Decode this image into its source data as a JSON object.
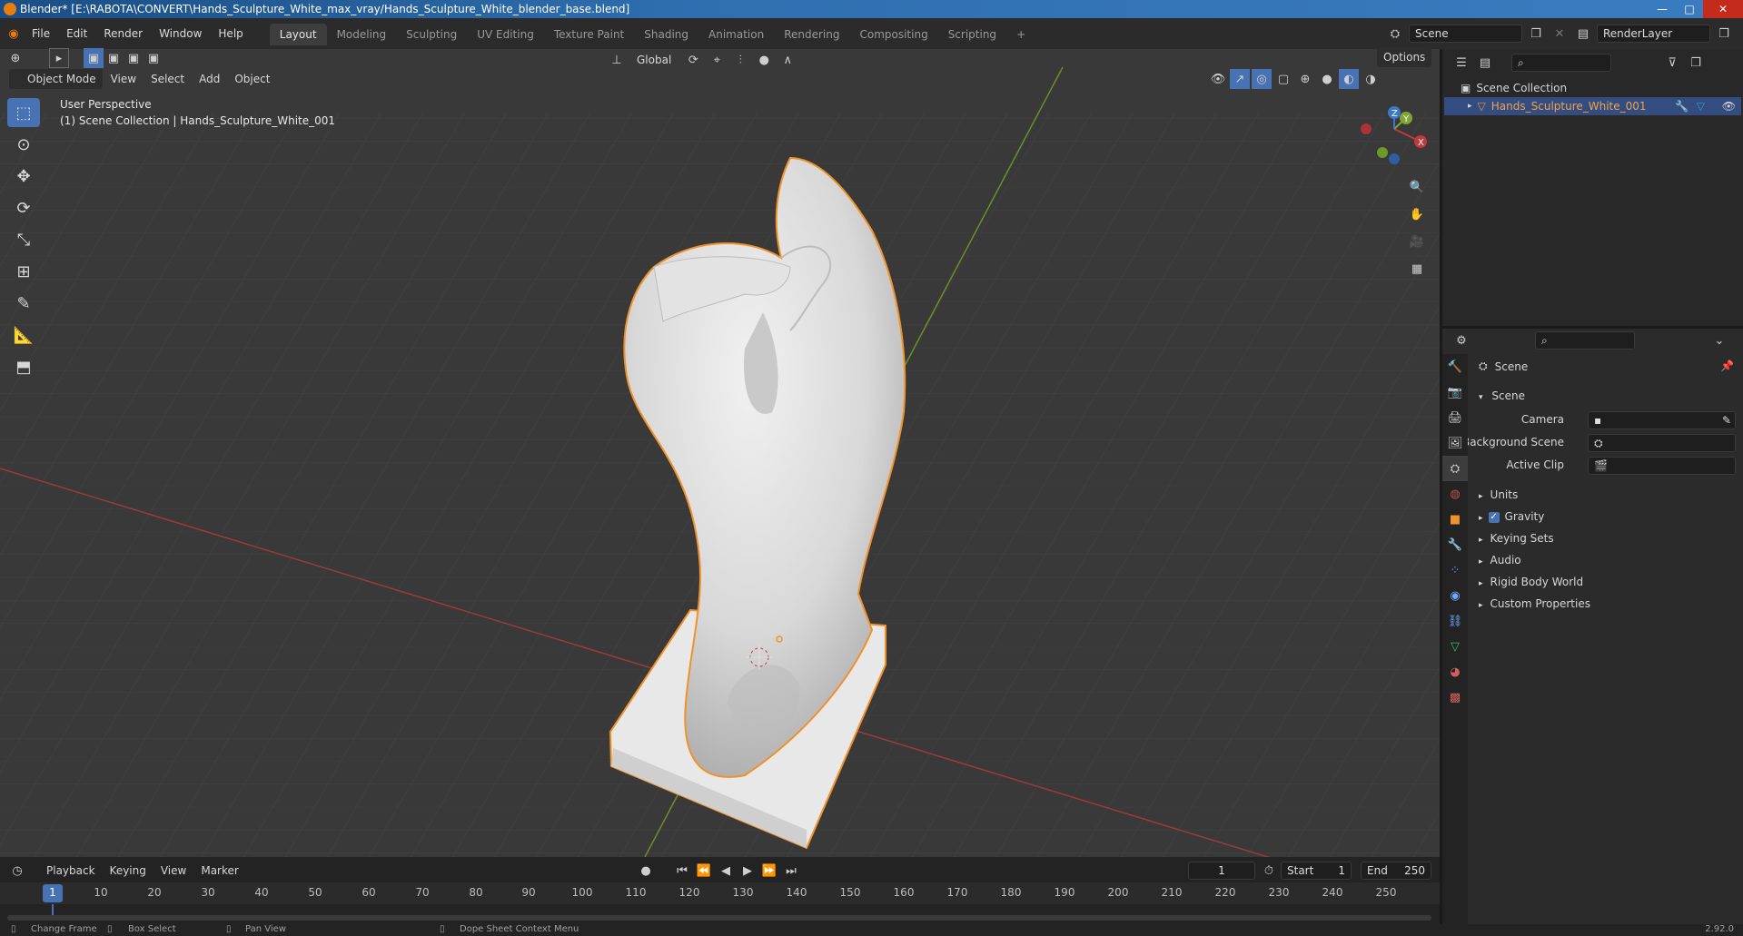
{
  "window": {
    "title": "Blender* [E:\\RABOTA\\CONVERT\\Hands_Sculpture_White_max_vray/Hands_Sculpture_White_blender_base.blend]",
    "minimize": "—",
    "maximize": "□",
    "close": "✕"
  },
  "menu": [
    "File",
    "Edit",
    "Render",
    "Window",
    "Help"
  ],
  "workspaces": [
    "Layout",
    "Modeling",
    "Sculpting",
    "UV Editing",
    "Texture Paint",
    "Shading",
    "Animation",
    "Rendering",
    "Compositing",
    "Scripting"
  ],
  "active_workspace": "Layout",
  "add_workspace": "+",
  "scene_field": "Scene",
  "renderlayer_field": "RenderLayer",
  "viewport_header": {
    "transform_orientation": "Global",
    "options": "Options",
    "mode": "Object Mode",
    "menus": [
      "View",
      "Select",
      "Add",
      "Object"
    ]
  },
  "viewport_overlay": {
    "line1": "User Perspective",
    "line2": "(1) Scene Collection | Hands_Sculpture_White_001"
  },
  "gizmo": {
    "x": "X",
    "y": "Y",
    "z": "Z"
  },
  "outliner": {
    "root": "Scene Collection",
    "object": "Hands_Sculpture_White_001"
  },
  "properties": {
    "context": "Scene",
    "panel": "Scene",
    "camera_label": "Camera",
    "background_scene_label": "Background Scene",
    "active_clip_label": "Active Clip",
    "sections": [
      "Units",
      "Gravity",
      "Keying Sets",
      "Audio",
      "Rigid Body World",
      "Custom Properties"
    ],
    "gravity_checked": true
  },
  "timeline": {
    "menus": [
      "Playback",
      "Keying",
      "View",
      "Marker"
    ],
    "current_frame": "1",
    "start_label": "Start",
    "start": "1",
    "end_label": "End",
    "end": "250",
    "ticks": [
      "1",
      "10",
      "20",
      "30",
      "40",
      "50",
      "60",
      "70",
      "80",
      "90",
      "100",
      "110",
      "120",
      "130",
      "140",
      "150",
      "160",
      "170",
      "180",
      "190",
      "200",
      "210",
      "220",
      "230",
      "240",
      "250"
    ]
  },
  "statusbar": {
    "items": [
      "Change Frame",
      "Box Select",
      "Pan View",
      "Dope Sheet Context Menu"
    ],
    "version": "2.92.0"
  },
  "colors": {
    "accent": "#4772b3",
    "selection_outline": "#f0922a",
    "x_axis": "#c0393d",
    "y_axis": "#7fa634",
    "z_axis": "#3b78cc"
  }
}
